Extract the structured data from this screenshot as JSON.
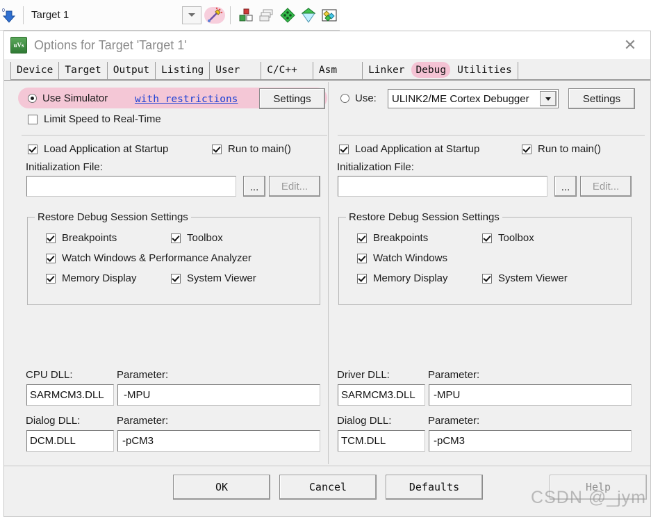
{
  "ide_toolbar": {
    "target_name": "Target 1",
    "icons": [
      {
        "name": "download-icon"
      },
      {
        "name": "target-dropdown-arrow-icon"
      },
      {
        "name": "magic-wand-configure-icon",
        "highlighted": true
      },
      {
        "name": "manage-project-items-icon"
      },
      {
        "name": "manage-run-time-environment-icon"
      },
      {
        "name": "batch-build-icon"
      },
      {
        "name": "build-target-icon"
      },
      {
        "name": "rebuild-all-icon"
      }
    ]
  },
  "dialog": {
    "title": "Options for Target 'Target 1'",
    "app_icon_text": "uVs",
    "close_label": "✕",
    "tabs": [
      {
        "label": "Device",
        "selected": false,
        "highlighted": false
      },
      {
        "label": "Target",
        "selected": false,
        "highlighted": false
      },
      {
        "label": "Output",
        "selected": false,
        "highlighted": false
      },
      {
        "label": "Listing",
        "selected": false,
        "highlighted": false
      },
      {
        "label": "User",
        "selected": false,
        "highlighted": false
      },
      {
        "label": "C/C++",
        "selected": false,
        "highlighted": false
      },
      {
        "label": "Asm",
        "selected": false,
        "highlighted": false
      },
      {
        "label": "Linker",
        "selected": false,
        "highlighted": false
      },
      {
        "label": "Debug",
        "selected": true,
        "highlighted": true
      },
      {
        "label": "Utilities",
        "selected": false,
        "highlighted": false
      }
    ]
  },
  "left_panel": {
    "use_simulator": {
      "label": "Use Simulator",
      "checked": true,
      "link_label": "with restrictions",
      "settings_label": "Settings",
      "highlighted": true
    },
    "limit_speed": {
      "label": "Limit Speed to Real-Time",
      "checked": false
    },
    "load_app": {
      "label": "Load Application at Startup",
      "checked": true
    },
    "run_to_main": {
      "label": "Run to main()",
      "checked": true
    },
    "init_file": {
      "label": "Initialization File:",
      "value": "",
      "placeholder": "",
      "browse_label": "...",
      "edit_label": "Edit...",
      "edit_disabled": true
    },
    "restore_group": {
      "title": "Restore Debug Session Settings",
      "items": [
        {
          "label": "Breakpoints",
          "checked": true
        },
        {
          "label": "Toolbox",
          "checked": true
        },
        {
          "label": "Watch Windows & Performance Analyzer",
          "checked": true
        },
        {
          "label": "Memory Display",
          "checked": true
        },
        {
          "label": "System Viewer",
          "checked": true
        }
      ]
    },
    "dll": {
      "cpu_dll_label": "CPU DLL:",
      "cpu_dll_value": "SARMCM3.DLL",
      "cpu_param_label": "Parameter:",
      "cpu_param_value": "-MPU",
      "dialog_dll_label": "Dialog DLL:",
      "dialog_dll_value": "DCM.DLL",
      "dialog_param_label": "Parameter:",
      "dialog_param_value": "-pCM3"
    }
  },
  "right_panel": {
    "use_driver": {
      "label": "Use:",
      "checked": false,
      "selected_driver": "ULINK2/ME Cortex Debugger",
      "settings_label": "Settings"
    },
    "load_app": {
      "label": "Load Application at Startup",
      "checked": true
    },
    "run_to_main": {
      "label": "Run to main()",
      "checked": true
    },
    "init_file": {
      "label": "Initialization File:",
      "value": "",
      "placeholder": "",
      "browse_label": "...",
      "edit_label": "Edit...",
      "edit_disabled": true
    },
    "restore_group": {
      "title": "Restore Debug Session Settings",
      "items": [
        {
          "label": "Breakpoints",
          "checked": true
        },
        {
          "label": "Toolbox",
          "checked": true
        },
        {
          "label": "Watch Windows",
          "checked": true
        },
        {
          "label": "Memory Display",
          "checked": true
        },
        {
          "label": "System Viewer",
          "checked": true
        }
      ]
    },
    "dll": {
      "driver_dll_label": "Driver DLL:",
      "driver_dll_value": "SARMCM3.DLL",
      "driver_param_label": "Parameter:",
      "driver_param_value": "-MPU",
      "dialog_dll_label": "Dialog DLL:",
      "dialog_dll_value": "TCM.DLL",
      "dialog_param_label": "Parameter:",
      "dialog_param_value": "-pCM3"
    }
  },
  "footer": {
    "ok_label": "OK",
    "cancel_label": "Cancel",
    "defaults_label": "Defaults",
    "help_label": "Help",
    "help_disabled": true
  },
  "watermark": {
    "text": "CSDN @_jym"
  },
  "colors": {
    "dialog_bg": "#f0f0f0",
    "highlight_pink": "#f4c3d4",
    "link_blue": "#1a3fd4",
    "title_gray": "#8a8a8a"
  }
}
